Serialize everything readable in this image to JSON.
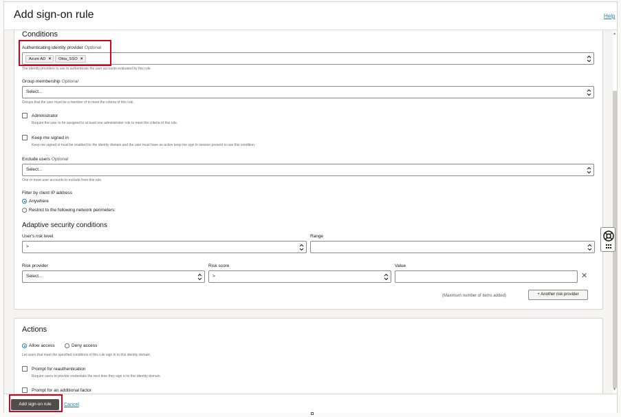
{
  "header": {
    "title": "Add sign-on rule",
    "help_label": "Help"
  },
  "conditions": {
    "title": "Conditions",
    "idp": {
      "label": "Authenticating identity provider",
      "optional": "Optional",
      "chips": [
        "Azure AD",
        "Okta_SSO"
      ],
      "help": "The identity providers to use to authenticate the user accounts evaluated by this rule."
    },
    "group": {
      "label": "Group membership",
      "optional": "Optional",
      "placeholder": "Select...",
      "help": "Groups that the user must be a member of to meet the criteria of this rule."
    },
    "admin": {
      "label": "Administrator",
      "help": "Require the user to be assigned to at least one administrator role to meet the criteria of this rule."
    },
    "kmsi": {
      "label": "Keep me signed in",
      "help": "Keep me signed in must be enabled for the identity domain and the user must have an active keep me sign in session present to use this condition."
    },
    "exclude": {
      "label": "Exclude users",
      "optional": "Optional",
      "placeholder": "Select...",
      "help": "One or more user accounts to exclude from this rule."
    },
    "ip_filter": {
      "label": "Filter by client IP address",
      "options": [
        "Anywhere",
        "Restrict to the following network perimeters:"
      ],
      "selected": "Anywhere"
    }
  },
  "adaptive": {
    "title": "Adaptive security conditions",
    "risk_level": {
      "label": "User's risk level",
      "value": ">"
    },
    "range": {
      "label": "Range",
      "value": ""
    },
    "risk_provider": {
      "label": "Risk provider",
      "placeholder": "Select..."
    },
    "risk_score": {
      "label": "Risk score",
      "value": ">"
    },
    "value": {
      "label": "Value",
      "value": ""
    },
    "max_note": "(Maximum number of items added)",
    "add_provider_label": "+ Another risk provider"
  },
  "actions": {
    "title": "Actions",
    "access_options": [
      "Allow access",
      "Deny access"
    ],
    "selected": "Allow access",
    "access_help": "Let users that meet the specified conditions of this rule sign in to this identity domain.",
    "reauth": {
      "label": "Prompt for reauthentication",
      "help": "Require users to provide credentials the next time they sign in to this identity domain."
    },
    "mfa": {
      "label": "Prompt for an additional factor"
    }
  },
  "footer": {
    "primary_label": "Add sign-on rule",
    "cancel_label": "Cancel"
  },
  "colors": {
    "accent": "#227e9e",
    "highlight": "#d0021b",
    "primary_button": "#4f4c49"
  }
}
